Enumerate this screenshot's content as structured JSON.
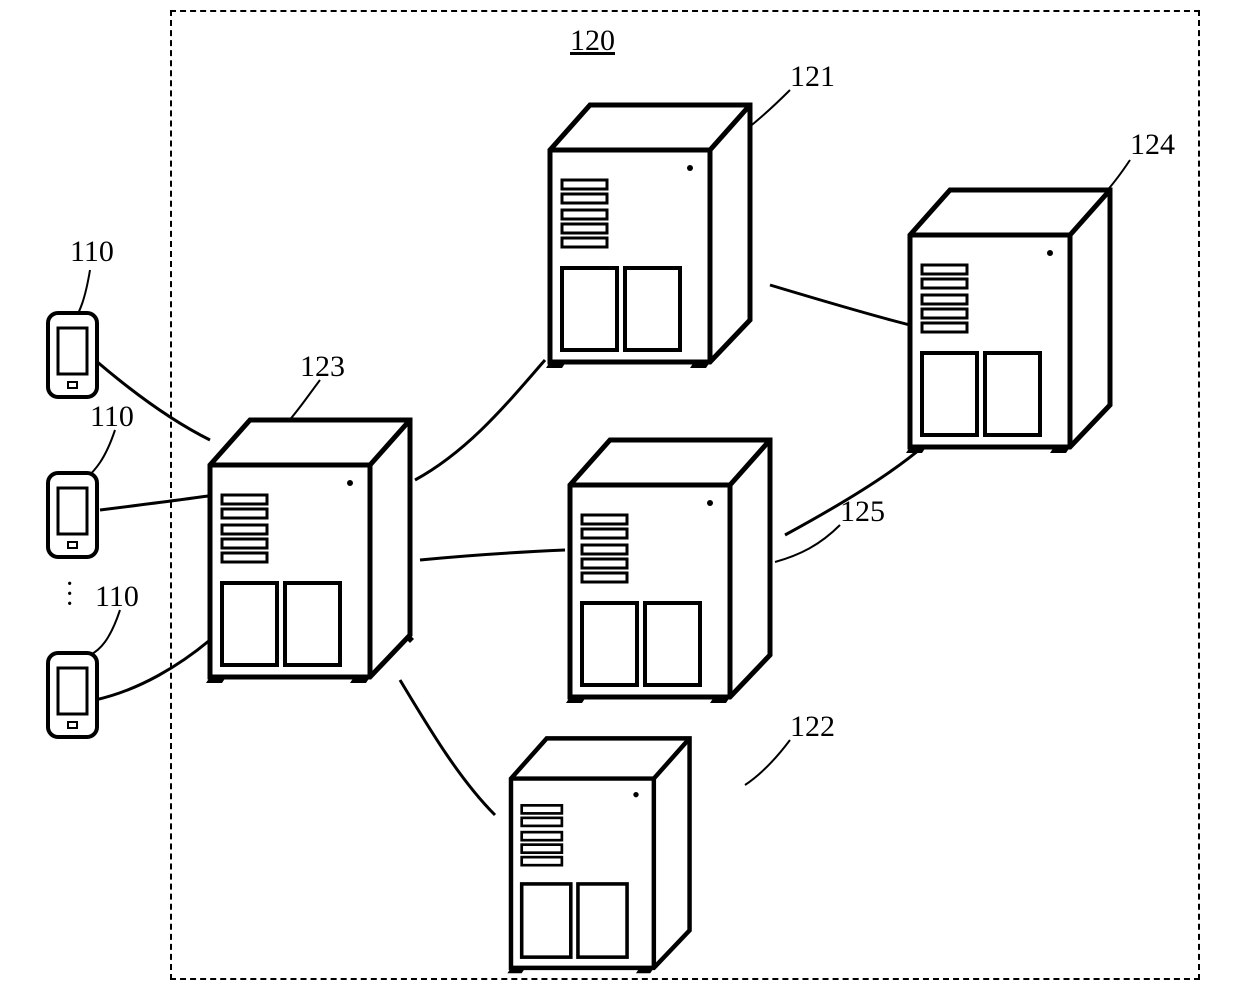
{
  "diagram": {
    "boundary_label": "120",
    "devices": [
      {
        "label": "110"
      },
      {
        "label": "110"
      },
      {
        "label": "110"
      }
    ],
    "servers": {
      "s121": {
        "label": "121"
      },
      "s122": {
        "label": "122"
      },
      "s123": {
        "label": "123"
      },
      "s124": {
        "label": "124"
      },
      "s125": {
        "label": "125"
      }
    }
  }
}
